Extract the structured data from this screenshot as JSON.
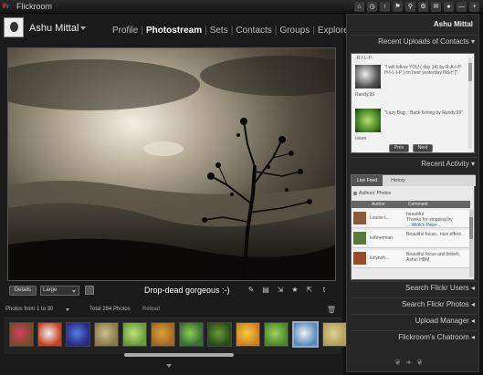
{
  "app": {
    "title": "Flickroom",
    "logo_f": "F",
    "logo_r": "r"
  },
  "top_icons": [
    "⌂",
    "◷",
    "↑",
    "⚑",
    "⚲",
    "⚙",
    "✉",
    "●",
    "—",
    "+"
  ],
  "top_icon_names": [
    "home-icon",
    "clock-icon",
    "upload-icon",
    "rss-icon",
    "search-icon",
    "settings-icon",
    "mail-icon",
    "status-icon",
    "minimize-icon",
    "maximize-icon"
  ],
  "user": {
    "name": "Ashu Mittal"
  },
  "nav": {
    "items": [
      {
        "label": "Profile",
        "active": false
      },
      {
        "label": "Photostream",
        "active": true
      },
      {
        "label": "Sets",
        "active": false
      },
      {
        "label": "Contacts",
        "active": false
      },
      {
        "label": "Groups",
        "active": false
      },
      {
        "label": "Explored",
        "active": false
      }
    ]
  },
  "photo": {
    "title": "Drop-dead gorgeous :-)"
  },
  "toolbar": {
    "details_label": "Details",
    "size_value": "Large"
  },
  "tool_icons": [
    "✎",
    "▤",
    "⇲",
    "★",
    "⇱",
    "t"
  ],
  "tool_icon_names": [
    "edit-icon",
    "comment-icon",
    "download-icon",
    "favorite-icon",
    "share-icon",
    "tumblr-icon"
  ],
  "photos_info": {
    "range": "Photos from 1 to 30",
    "total": "Total 284 Photos",
    "reload": "Reload"
  },
  "thumbs": [
    {
      "name": "thumb-flowers",
      "color": "#7a4a2a",
      "color2": "#d04060"
    },
    {
      "name": "thumb-abstract",
      "color": "#c84020",
      "color2": "#f0f0f0"
    },
    {
      "name": "thumb-flickr-logo",
      "color": "#2a2a8a",
      "color2": "#5080e0"
    },
    {
      "name": "thumb-ruins",
      "color": "#8a7a4a",
      "color2": "#d0c090"
    },
    {
      "name": "thumb-leaf",
      "color": "#6a9a3a",
      "color2": "#c0e080"
    },
    {
      "name": "thumb-autumn",
      "color": "#a06a20",
      "color2": "#e0a040"
    },
    {
      "name": "thumb-pattern",
      "color": "#3a6a3a",
      "color2": "#8ad04a"
    },
    {
      "name": "thumb-macro",
      "color": "#2a4a1a",
      "color2": "#6a9a3a"
    },
    {
      "name": "thumb-orange-flower",
      "color": "#d08020",
      "color2": "#f0d040"
    },
    {
      "name": "thumb-green",
      "color": "#4a8a2a",
      "color2": "#a0d060"
    },
    {
      "name": "thumb-blue-flower",
      "color": "#5a8ac0",
      "color2": "#f0f0f0"
    },
    {
      "name": "thumb-sand",
      "color": "#b0a060",
      "color2": "#e0d090"
    }
  ],
  "right_panel": {
    "user": "Ashu Mittal",
    "recent_uploads_title": "Recent Uploads of Contacts",
    "uploads": [
      {
        "dash": "-R-I-L-P-",
        "text": "\"I will follow YOU ( day 14) by R-A-I-P-H-I-L-I-P ] on best yesterday flickr! ]\"",
        "user": "Randy.99"
      },
      {
        "text": "\"Lazy Bug :: Back fishing by Randy.99\"",
        "user": "Isiuro"
      }
    ],
    "prev_label": "Prev",
    "next_label": "Next",
    "recent_activity_title": "Recent Activity",
    "tabs": [
      "Live Feed",
      "History"
    ],
    "authors_label": "Authors' Photos",
    "col_author": "Author",
    "col_comment": "Comment",
    "activity": [
      {
        "author": "Louise L...",
        "comment": "beautiful",
        "comment2": "Thanks for stopping by",
        "link": "... Wink's Pace-...",
        "thumb": "#8a5a3a"
      },
      {
        "author": "kohnerman",
        "comment": "Beautiful focus.. nice effect",
        "thumb": "#5a7a3a"
      },
      {
        "author": "lucynsh...",
        "comment": "Beautiful focus and bokeh, Ashu! HBM",
        "thumb": "#9a4a2a"
      }
    ],
    "collapsed_sections": [
      "Search Flickr Users",
      "Search Flickr Photos",
      "Upload Manager",
      "Flickroom's Chatroom"
    ],
    "ornament": "❦ ❧ ❦"
  }
}
